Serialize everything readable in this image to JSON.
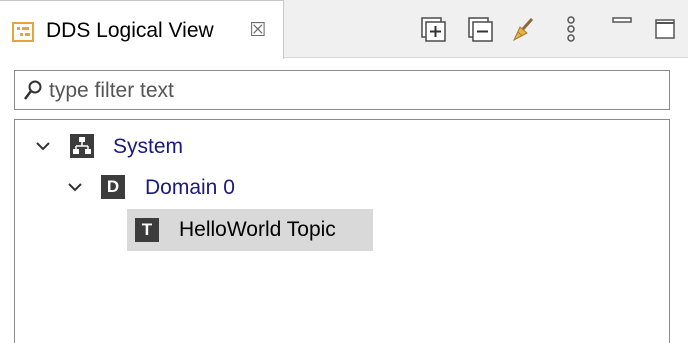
{
  "view": {
    "title": "DDS Logical View",
    "close_glyph": "☒",
    "icons": {
      "view": "tree-view-icon",
      "close": "close-tab-icon"
    }
  },
  "toolbar": {
    "items": [
      {
        "name": "expand-all-button",
        "icon": "expand-all-icon"
      },
      {
        "name": "collapse-all-button",
        "icon": "collapse-all-icon"
      },
      {
        "name": "clear-button",
        "icon": "broom-icon"
      },
      {
        "name": "view-menu-button",
        "icon": "vertical-dots-icon"
      },
      {
        "name": "minimize-button",
        "icon": "minimize-icon"
      },
      {
        "name": "maximize-button",
        "icon": "maximize-icon"
      }
    ]
  },
  "filter": {
    "placeholder": "type filter text",
    "value": "",
    "icon": "search-icon"
  },
  "tree": {
    "nodes": [
      {
        "label": "System",
        "icon_letter": "",
        "icon": "system-hierarchy-icon",
        "expanded": true,
        "selected": false,
        "label_color": "#1a1a7a"
      },
      {
        "label": "Domain 0",
        "icon_letter": "D",
        "icon": "domain-icon",
        "expanded": true,
        "selected": false,
        "label_color": "#1a1a7a"
      },
      {
        "label": "HelloWorld Topic",
        "icon_letter": "T",
        "icon": "topic-icon",
        "expanded": false,
        "selected": true,
        "label_color": "#000000"
      }
    ]
  },
  "colors": {
    "tab_icon_accent": "#e8a33d",
    "tree_icon_bg": "#3c3c3c",
    "selection_bg": "#d9d9d9"
  }
}
